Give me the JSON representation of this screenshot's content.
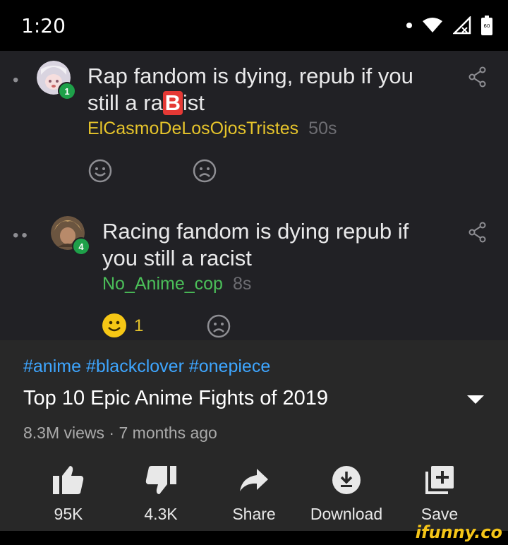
{
  "status": {
    "time": "1:20",
    "battery_text": "60"
  },
  "comments": [
    {
      "text_before": "Rap fandom is dying, repub if you still a ra",
      "badge_char": "B",
      "text_after": "ist",
      "user": "ElCasmoDeLosOjosTristes",
      "time": "50s",
      "level": "1",
      "like_count": ""
    },
    {
      "text": "Racing fandom is dying repub if you still a racist",
      "user": "No_Anime_cop",
      "time": "8s",
      "level": "4",
      "like_count": "1"
    }
  ],
  "video": {
    "tags": "#anime #blackclover #onepiece",
    "title": "Top 10 Epic Anime Fights of 2019",
    "meta": "8.3M views · 7 months ago",
    "actions": [
      {
        "icon": "thumbs-up-icon",
        "label": "95K"
      },
      {
        "icon": "thumbs-down-icon",
        "label": "4.3K"
      },
      {
        "icon": "share-icon",
        "label": "Share"
      },
      {
        "icon": "download-icon",
        "label": "Download"
      },
      {
        "icon": "add-to-playlist-icon",
        "label": "Save"
      }
    ]
  },
  "watermark": "ifunny.co",
  "colors": {
    "username_yellow": "#e6c42b",
    "username_green": "#4bbf59",
    "hashtag_blue": "#3ea6ff",
    "panel_bg": "#282828",
    "comments_bg": "#212125"
  }
}
